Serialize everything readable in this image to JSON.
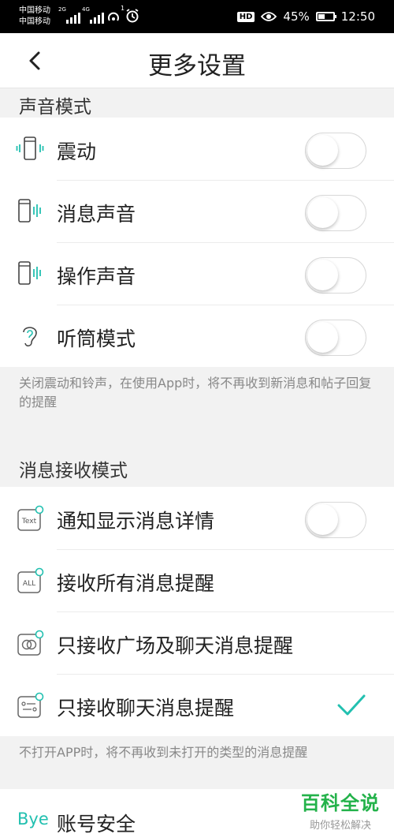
{
  "status_bar": {
    "carrier1": "中国移动",
    "carrier2": "中国移动",
    "net1": "2G",
    "net2": "4G",
    "alarm_badge": "1",
    "hd": "HD",
    "battery": "45%",
    "battery_level": 0.45,
    "time": "12:50"
  },
  "header": {
    "title": "更多设置",
    "back_icon": "back-arrow-icon"
  },
  "sound_section": {
    "title": "声音模式",
    "items": [
      {
        "label": "震动",
        "icon": "vibrate-phone-icon",
        "enabled": false
      },
      {
        "label": "消息声音",
        "icon": "message-sound-phone-icon",
        "enabled": false
      },
      {
        "label": "操作声音",
        "icon": "operation-sound-phone-icon",
        "enabled": false
      },
      {
        "label": "听筒模式",
        "icon": "ear-icon",
        "enabled": false
      }
    ],
    "note": "关闭震动和铃声，在使用App时，将不再收到新消息和帖子回复的提醒"
  },
  "receive_section": {
    "title": "消息接收模式",
    "items": [
      {
        "label": "通知显示消息详情",
        "icon": "text-badge-icon",
        "icon_text": "Text",
        "control": "toggle",
        "enabled": false
      },
      {
        "label": "接收所有消息提醒",
        "icon": "all-badge-icon",
        "icon_text": "ALL",
        "control": "radio",
        "selected": false
      },
      {
        "label": "只接收广场及聊天消息提醒",
        "icon": "square-chat-badge-icon",
        "control": "radio",
        "selected": false
      },
      {
        "label": "只接收聊天消息提醒",
        "icon": "chat-badge-icon",
        "control": "radio",
        "selected": true
      }
    ],
    "note": "不打开APP时，将不再收到未打开的类型的消息提醒"
  },
  "account": {
    "label": "账号安全",
    "icon_text": "Bye"
  },
  "watermark": {
    "title": "百科全说",
    "subtitle": "助你轻松解决"
  },
  "colors": {
    "accent": "#22c0b0",
    "watermark": "#23b24a",
    "statusbar": "#000000"
  }
}
